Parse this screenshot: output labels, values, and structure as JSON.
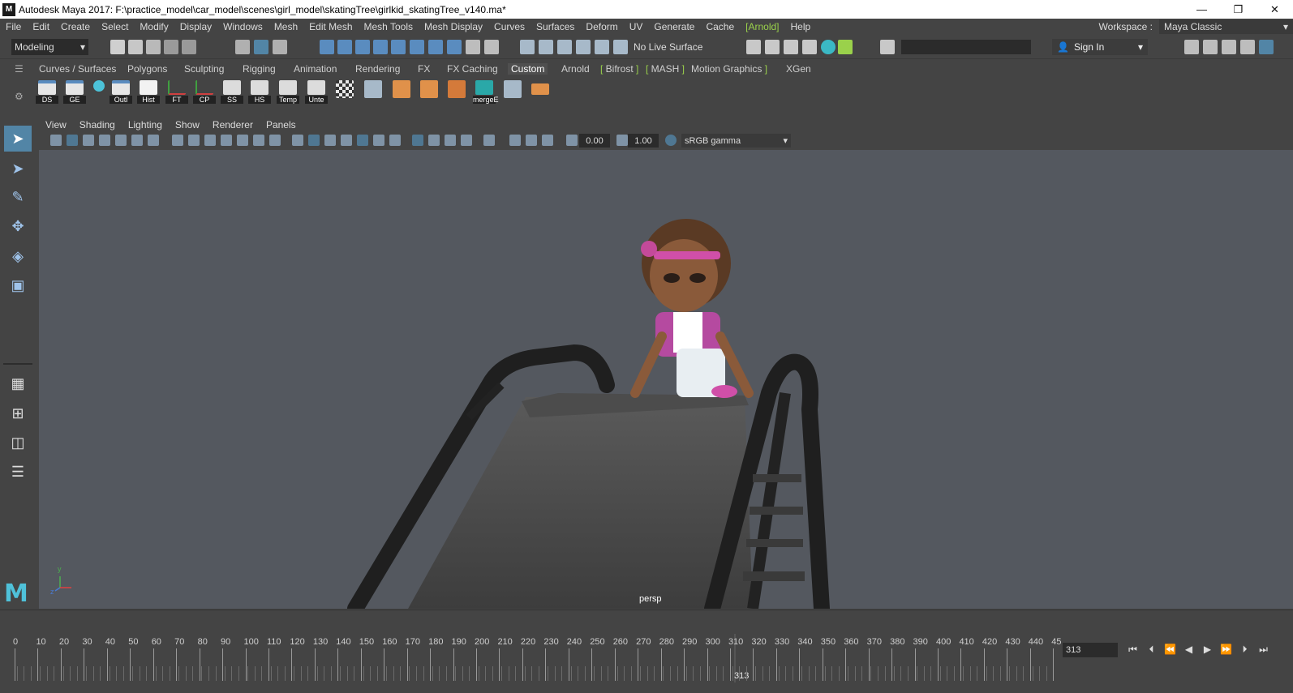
{
  "window": {
    "title": "Autodesk Maya 2017: F:\\practice_model\\car_model\\scenes\\girl_model\\skatingTree\\girlkid_skatingTree_v140.ma*",
    "app_icon": "M",
    "minimize": "—",
    "restore": "❐",
    "close": "✕"
  },
  "menu": [
    "File",
    "Edit",
    "Create",
    "Select",
    "Modify",
    "Display",
    "Windows",
    "Mesh",
    "Edit Mesh",
    "Mesh Tools",
    "Mesh Display",
    "Curves",
    "Surfaces",
    "Deform",
    "UV",
    "Generate",
    "Cache",
    "[Arnold]",
    "Help"
  ],
  "workspace": {
    "label": "Workspace :",
    "value": "Maya Classic"
  },
  "status": {
    "mode": "Modeling",
    "live_surface": "No Live Surface",
    "sign_in": "Sign In"
  },
  "shelf_tabs": [
    "Curves / Surfaces",
    "Polygons",
    "Sculpting",
    "Rigging",
    "Animation",
    "Rendering",
    "FX",
    "FX Caching",
    "Custom",
    "Arnold",
    "Bifrost",
    "MASH",
    "Motion Graphics",
    "XGen"
  ],
  "shelf_active": "Custom",
  "shelf_buttons": [
    "DS",
    "GE",
    "",
    "Outl",
    "Hist",
    "FT",
    "CP",
    "SS",
    "HS",
    "Temp",
    "Unte",
    "",
    "",
    "",
    "",
    "",
    "",
    "mergeE",
    "",
    ""
  ],
  "panel_menu": [
    "View",
    "Shading",
    "Lighting",
    "Show",
    "Renderer",
    "Panels"
  ],
  "panel_toolbar": {
    "exposure": "0.00",
    "gamma": "1.00",
    "color_space": "sRGB gamma"
  },
  "viewport": {
    "camera": "persp",
    "axis_y": "y",
    "axis_z": "z"
  },
  "timeline": {
    "ticks": [
      "0",
      "10",
      "20",
      "30",
      "40",
      "50",
      "60",
      "70",
      "80",
      "90",
      "100",
      "110",
      "120",
      "130",
      "140",
      "150",
      "160",
      "170",
      "180",
      "190",
      "200",
      "210",
      "220",
      "230",
      "240",
      "250",
      "260",
      "270",
      "280",
      "290",
      "300",
      "310",
      "320",
      "330",
      "340",
      "350",
      "360",
      "370",
      "380",
      "390",
      "400",
      "410",
      "420",
      "430",
      "440",
      "45"
    ],
    "current_frame": "313",
    "current_frame_field": "313"
  },
  "colors": {
    "accent": "#5285a6",
    "arnold": "#9ad14b",
    "key": "#e8a23a",
    "viewport_bg": "#54585f"
  }
}
